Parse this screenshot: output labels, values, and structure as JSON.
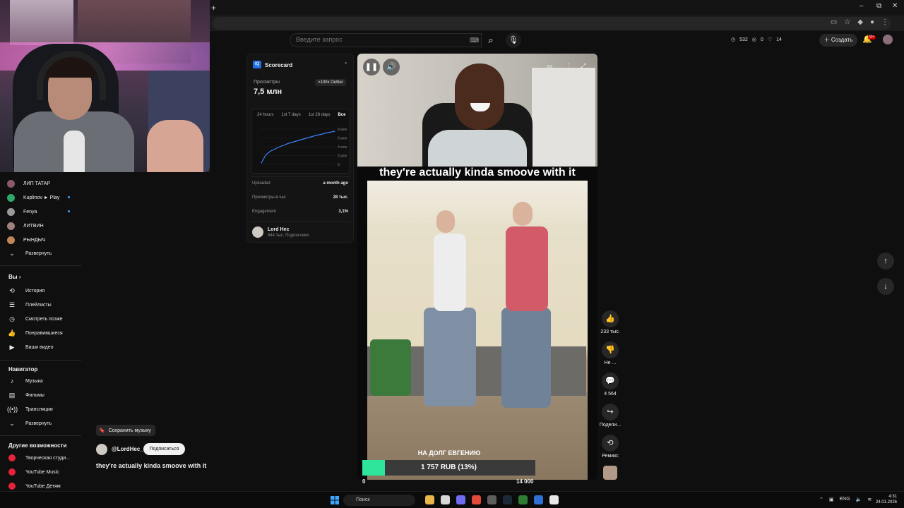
{
  "browser": {
    "new_tab": "+",
    "win_min": "–",
    "win_max": "⧉",
    "win_close": "✕"
  },
  "search": {
    "placeholder": "Введите запрос"
  },
  "header_stats": {
    "a": "532",
    "b": "0",
    "c": "14"
  },
  "header": {
    "create_label": "Создать",
    "notif_badge": "9+"
  },
  "scorecard": {
    "title": "Scorecard",
    "views_label": "Просмотры",
    "views_value": "7,5 млн",
    "outlier_badge": ">100x Outlier",
    "ranges": [
      "24 hours",
      "1st 7 days",
      "1st 28 days",
      "Все"
    ],
    "active_range": "Все",
    "y_ticks": [
      "8 млн",
      "6 млн",
      "4 млн",
      "2 млн",
      "0"
    ],
    "rows": [
      {
        "label": "Uploaded",
        "value": "a month ago"
      },
      {
        "label": "Просмотры в час",
        "value": "28 тыс."
      },
      {
        "label": "Engagement",
        "value": "3,1%"
      }
    ],
    "channel_name": "Lord Hec",
    "channel_subs": "944 тыс. Подписчики"
  },
  "chart_data": {
    "type": "line",
    "y": [
      0.3,
      2.2,
      3.0,
      3.5,
      4.0,
      4.4,
      4.8,
      5.1,
      5.4,
      5.7,
      6.0,
      6.3,
      6.6,
      6.8,
      7.1,
      7.3,
      7.5
    ],
    "ylim": [
      0,
      8
    ],
    "y_ticks": [
      "8 млн",
      "6 млн",
      "4 млн",
      "2 млн",
      "0"
    ],
    "color": "#3b82f6",
    "grid": true
  },
  "video": {
    "caption": "they're actually kinda smoove with it",
    "donation_title": "НА ДОЛГ ЕВГЕНИЮ",
    "donation_amount": "1 757 RUB (13%)",
    "donation_progress": 0.13,
    "donation_min": "0",
    "donation_max": "14 000"
  },
  "actions": {
    "likes": "233 тыс.",
    "dislike": "Не ...",
    "comments": "4 564",
    "share": "Подели...",
    "remix": "Ремикс"
  },
  "sidebar": {
    "subscriptions": [
      {
        "label": "ЛИП ТАТАР",
        "color": "#8a5a6a",
        "live": false
      },
      {
        "label": "Kuplinov ► Play",
        "color": "#2fa76b",
        "live": true
      },
      {
        "label": "Fenya",
        "color": "#9a9a9a",
        "live": true
      },
      {
        "label": "ЛИТВИН",
        "color": "#a0807a",
        "live": false
      },
      {
        "label": "РЫНДЫЧ",
        "color": "#c2855a",
        "live": false
      }
    ],
    "expand": "Развернуть",
    "you_header": "Вы",
    "you_items": [
      "История",
      "Плейлисты",
      "Смотреть позже",
      "Понравившиеся",
      "Ваши видео"
    ],
    "nav_header": "Навигатор",
    "nav_items": [
      "Музыка",
      "Фильмы",
      "Трансляции",
      "Развернуть"
    ],
    "more_header": "Другие возможности",
    "more_items": [
      "Творческая студи...",
      "YouTube Music",
      "YouTube Детям"
    ]
  },
  "info": {
    "save_music": "Сохранить музыку",
    "channel": "@LordHec_",
    "subscribe": "Подписаться",
    "title": "they're actually kinda smoove with it"
  },
  "taskbar": {
    "search": "Поиск",
    "lang": "ENG",
    "time": "4:31",
    "date": "24.01.2026"
  }
}
